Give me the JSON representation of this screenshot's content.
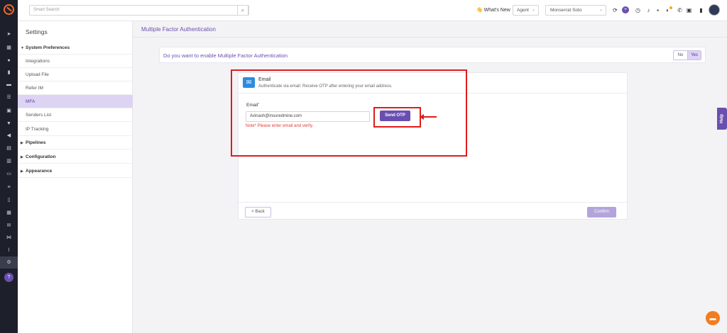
{
  "topbar": {
    "search_placeholder": "Smart Search",
    "whats_new": "What's New",
    "role": "Agent",
    "user": "Monserrat Soto"
  },
  "settings": {
    "title": "Settings",
    "items": [
      {
        "label": "System Preferences",
        "group": true
      },
      {
        "label": "Integrations"
      },
      {
        "label": "Upload File"
      },
      {
        "label": "Refer IM"
      },
      {
        "label": "MFA",
        "active": true
      },
      {
        "label": "Senders List"
      },
      {
        "label": "IP Tracking"
      },
      {
        "label": "Pipelines",
        "group": true
      },
      {
        "label": "Configuration",
        "group": true
      },
      {
        "label": "Appearance",
        "group": true
      }
    ]
  },
  "main": {
    "title": "Multiple Factor Authentication",
    "question": "Do you want to enable Multiple Factor Authentication",
    "toggle": {
      "no": "No",
      "yes": "Yes",
      "selected": "Yes"
    }
  },
  "card": {
    "title": "Email",
    "description": "Authenticate via email: Receive OTP after entering your email address.",
    "email_label": "Email",
    "required_mark": "*",
    "email_value": "Avinash@insuredmine.com",
    "send_otp": "Send OTP",
    "note": "Note* Please enter email and verify.",
    "back": "< Back",
    "confirm": "Confirm"
  },
  "help_tab": "Help",
  "colors": {
    "accent": "#6a4fb0",
    "annotation": "#e01c1c",
    "chat": "#f47c20"
  }
}
